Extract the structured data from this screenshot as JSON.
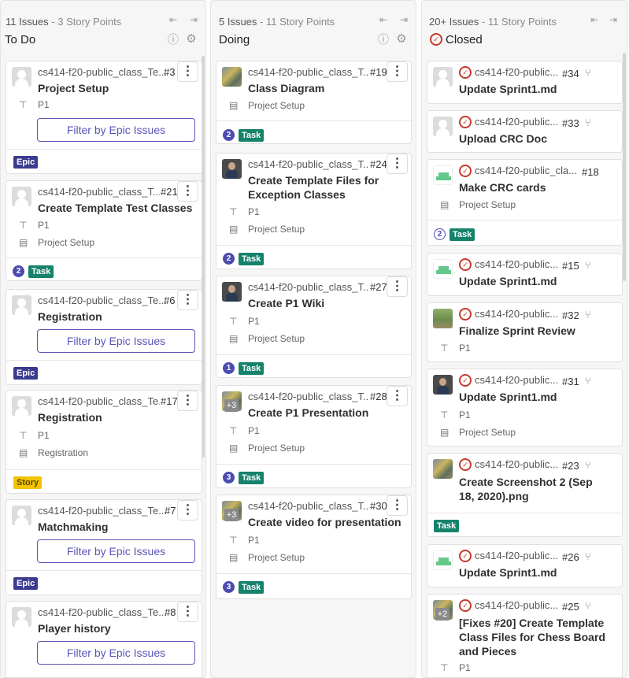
{
  "columns": [
    {
      "meta_count": "11 Issues",
      "meta_sep": " - ",
      "meta_points": "3 Story Points",
      "title": "To Do",
      "cards": [
        {
          "project": "cs414-f20-public_class_Te...",
          "number": "#3",
          "title": "Project Setup",
          "milestone": "P1",
          "button": "Filter by Epic Issues",
          "badge": "Epic"
        },
        {
          "project": "cs414-f20-public_class_T...",
          "number": "#21",
          "title": "Create Template Test Classes",
          "milestone": "P1",
          "epic": "Project Setup",
          "points": "2",
          "badge": "Task"
        },
        {
          "project": "cs414-f20-public_class_Te...",
          "number": "#6",
          "title": "Registration",
          "button": "Filter by Epic Issues",
          "badge": "Epic"
        },
        {
          "project": "cs414-f20-public_class_Te...",
          "number": "#17",
          "title": "Registration",
          "milestone": "P1",
          "epic": "Registration",
          "badge": "Story"
        },
        {
          "project": "cs414-f20-public_class_Te...",
          "number": "#7",
          "title": "Matchmaking",
          "button": "Filter by Epic Issues",
          "badge": "Epic"
        },
        {
          "project": "cs414-f20-public_class_Te...",
          "number": "#8",
          "title": "Player history",
          "button": "Filter by Epic Issues"
        }
      ]
    },
    {
      "meta_count": "5 Issues",
      "meta_sep": " - ",
      "meta_points": "11 Story Points",
      "title": "Doing",
      "cards": [
        {
          "project": "cs414-f20-public_class_T...",
          "number": "#19",
          "title": "Class Diagram",
          "epic": "Project Setup",
          "points": "2",
          "badge": "Task"
        },
        {
          "project": "cs414-f20-public_class_T...",
          "number": "#24",
          "title": "Create Template Files for Exception Classes",
          "milestone": "P1",
          "epic": "Project Setup",
          "points": "2",
          "badge": "Task"
        },
        {
          "project": "cs414-f20-public_class_T...",
          "number": "#27",
          "title": "Create P1 Wiki",
          "milestone": "P1",
          "epic": "Project Setup",
          "points": "1",
          "badge": "Task"
        },
        {
          "project": "cs414-f20-public_class_T...",
          "number": "#28",
          "title": "Create P1 Presentation",
          "milestone": "P1",
          "epic": "Project Setup",
          "points": "3",
          "badge": "Task",
          "plus": "+3"
        },
        {
          "project": "cs414-f20-public_class_T...",
          "number": "#30",
          "title": "Create video for presentation",
          "milestone": "P1",
          "epic": "Project Setup",
          "points": "3",
          "badge": "Task",
          "plus": "+3"
        }
      ]
    },
    {
      "meta_count": "20+ Issues",
      "meta_sep": " - ",
      "meta_points": "11 Story Points",
      "title": "Closed",
      "cards": [
        {
          "project": "cs414-f20-public...",
          "number": "#34",
          "title": "Update Sprint1.md"
        },
        {
          "project": "cs414-f20-public...",
          "number": "#33",
          "title": "Upload CRC Doc"
        },
        {
          "project": "cs414-f20-public_cla...",
          "number": "#18",
          "title": "Make CRC cards",
          "epic": "Project Setup",
          "points": "2",
          "badge": "Task"
        },
        {
          "project": "cs414-f20-public...",
          "number": "#15",
          "title": "Update Sprint1.md"
        },
        {
          "project": "cs414-f20-public...",
          "number": "#32",
          "title": "Finalize Sprint Review",
          "milestone": "P1"
        },
        {
          "project": "cs414-f20-public...",
          "number": "#31",
          "title": "Update Sprint1.md",
          "milestone": "P1",
          "epic": "Project Setup"
        },
        {
          "project": "cs414-f20-public...",
          "number": "#23",
          "title": "Create Screenshot 2 (Sep 18, 2020).png",
          "badge": "Task"
        },
        {
          "project": "cs414-f20-public...",
          "number": "#26",
          "title": "Update Sprint1.md"
        },
        {
          "project": "cs414-f20-public...",
          "number": "#25",
          "title": "[Fixes #20] Create Template Class Files for Chess Board and Pieces",
          "milestone": "P1",
          "plus": "+2"
        }
      ]
    }
  ],
  "icons": {
    "kebab": "⋮",
    "milestone": "⊤",
    "epic": "▤",
    "info": "ⓘ",
    "settings": "⚙",
    "collapse": "⇤",
    "expand": "⇥",
    "closed": "✓",
    "merge": "⑂"
  }
}
